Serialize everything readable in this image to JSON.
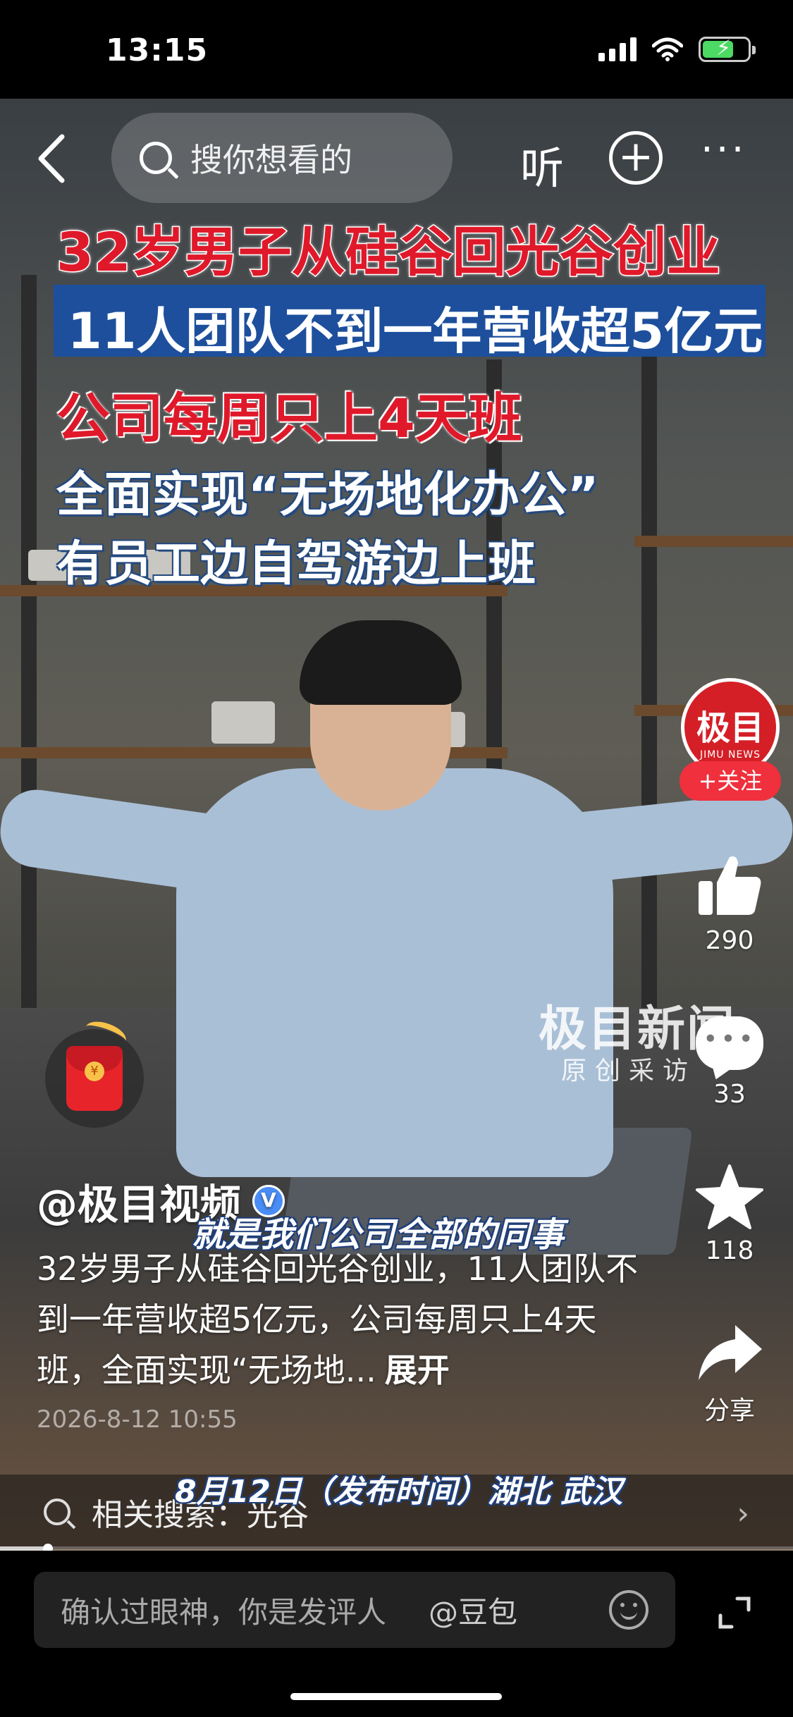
{
  "status_bar": {
    "time": "13:15",
    "battery_percent": 70
  },
  "top_bar": {
    "search_placeholder": "搜你想看的",
    "listen_label": "听",
    "back_icon": "chevron-left-icon",
    "add_icon": "plus-circle-icon",
    "more_icon": "ellipsis-icon"
  },
  "video": {
    "headline_1": "32岁男子从硅谷回光谷创业",
    "headline_2": "11人团队不到一年营收超5亿元",
    "headline_3": "公司每周只上4天班",
    "headline_4": "全面实现“无场地化办公”",
    "headline_5": "有员工边自驾游边上班",
    "watermark_main": "极目新闻",
    "watermark_sub": "原创采访",
    "subtitle": "就是我们公司全部的同事",
    "location_caption": "8月12日（发布时间）湖北 武汉"
  },
  "actions": {
    "avatar_label": "极目",
    "avatar_sub": "JIMU NEWS",
    "follow_label": "+关注",
    "like_count": "290",
    "comment_count": "33",
    "favorite_count": "118",
    "share_label": "分享"
  },
  "post": {
    "author": "@极目视频",
    "description": "32岁男子从硅谷回光谷创业，11人团队不到一年营收超5亿元，公司每周只上4天班，全面实现“无场地...",
    "expand_label": "展开",
    "date": "2026-8-12 10:55"
  },
  "related_search": {
    "label": "相关搜索：光谷"
  },
  "playback": {
    "progress": 0.06
  },
  "comment_bar": {
    "placeholder": "确认过眼神，你是发评人",
    "mention": "@豆包"
  },
  "colors": {
    "accent_red": "#f0303d",
    "headline_red": "#e0192a",
    "banner_blue": "#1d4f9c"
  }
}
